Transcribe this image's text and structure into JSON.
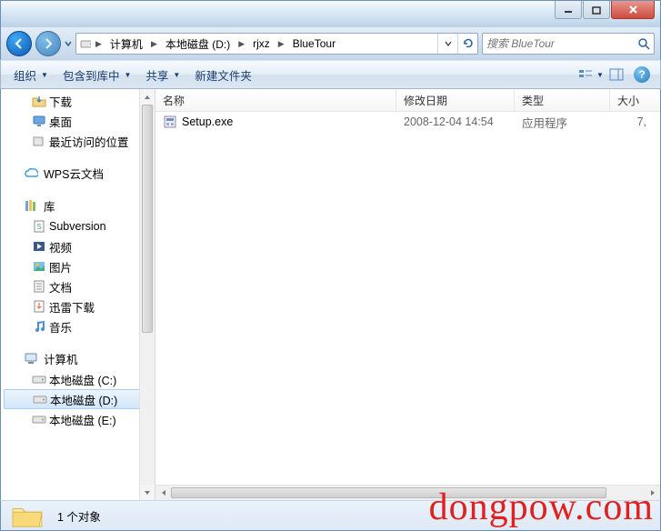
{
  "titlebar": {},
  "nav": {
    "breadcrumb": [
      "计算机",
      "本地磁盘 (D:)",
      "rjxz",
      "BlueTour"
    ],
    "search_placeholder": "搜索 BlueTour"
  },
  "toolbar": {
    "organize": "组织",
    "include": "包含到库中",
    "share": "共享",
    "newfolder": "新建文件夹"
  },
  "columns": {
    "name": "名称",
    "date": "修改日期",
    "type": "类型",
    "size": "大小"
  },
  "files": [
    {
      "name": "Setup.exe",
      "date": "2008-12-04 14:54",
      "type": "应用程序",
      "size": "7,"
    }
  ],
  "sidebar": {
    "top_items": [
      {
        "label": "下载",
        "icon": "download"
      },
      {
        "label": "桌面",
        "icon": "desktop"
      },
      {
        "label": "最近访问的位置",
        "icon": "recent"
      }
    ],
    "wps": "WPS云文档",
    "library_label": "库",
    "library_items": [
      {
        "label": "Subversion"
      },
      {
        "label": "视频"
      },
      {
        "label": "图片"
      },
      {
        "label": "文档"
      },
      {
        "label": "迅雷下载"
      },
      {
        "label": "音乐"
      }
    ],
    "computer_label": "计算机",
    "drives": [
      {
        "label": "本地磁盘 (C:)",
        "sel": false
      },
      {
        "label": "本地磁盘 (D:)",
        "sel": true
      },
      {
        "label": "本地磁盘 (E:)",
        "sel": false
      }
    ]
  },
  "details": {
    "count_label": "1 个对象"
  },
  "watermark": "dongpow.com"
}
